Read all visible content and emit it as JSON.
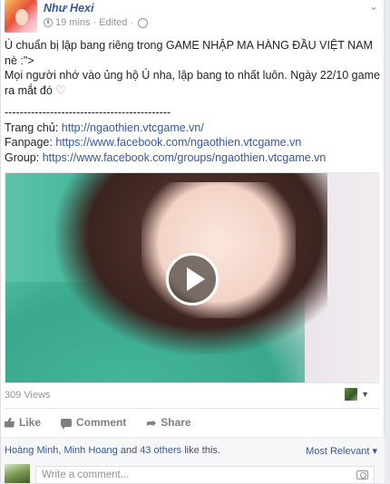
{
  "post": {
    "author": "Như Hexi",
    "time": "19 mins",
    "edited": "Edited",
    "separator": "·",
    "menu_icon": "chevron-down-icon",
    "lines": {
      "line1": "Ú chuẩn bị lập bang riêng trong GAME NHẬP MA HÀNG ĐẦU VIỆT NAM",
      "line2": "nè :\">",
      "line3": "Mọi người nhớ vào ủng hộ Ú nha, lập bang to nhất luôn. Ngày 22/10 game",
      "line4": "ra mắt đó",
      "dashes": "--------------------------------------------",
      "home_label": "Trang chủ:",
      "home_url": "http://ngaothien.vtcgame.vn/",
      "fanpage_label": "Fanpage:",
      "fanpage_url": "https://www.facebook.com/ngaothien.vtcgame.vn",
      "group_label": "Group:",
      "group_url": "https://www.facebook.com/groups/ngaothien.vtcgame.vn"
    }
  },
  "video": {
    "views": "309 Views"
  },
  "actions": {
    "like": "Like",
    "comment": "Comment",
    "share": "Share"
  },
  "reactions": {
    "name1": "Hoàng Minh",
    "comma": ",",
    "name2": "Minh Hoang",
    "and": "and",
    "others": "43 others",
    "suffix": "like this.",
    "sort": "Most Relevant"
  },
  "comment": {
    "placeholder": "Write a comment..."
  },
  "colors": {
    "link": "#365899",
    "muted": "#90949c",
    "heart": "#f0758a"
  }
}
